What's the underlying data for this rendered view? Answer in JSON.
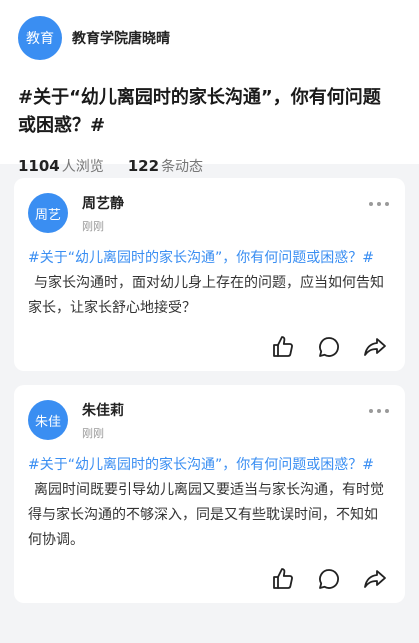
{
  "header": {
    "owner_avatar": "教育",
    "owner_name": "教育学院唐晓晴",
    "topic_title": "#关于“幼儿离园时的家长沟通”，你有何问题或困惑？#",
    "views_count": "1104",
    "views_label": "人浏览",
    "posts_count": "122",
    "posts_label": "条动态"
  },
  "posts": [
    {
      "avatar": "周艺",
      "name": "周艺静",
      "time": "刚刚",
      "tag": "#关于“幼儿离园时的家长沟通”，你有何问题或困惑？#",
      "text": "与家长沟通时，面对幼儿身上存在的问题，应当如何告知家长，让家长舒心地接受？"
    },
    {
      "avatar": "朱佳",
      "name": "朱佳莉",
      "time": "刚刚",
      "tag": "#关于“幼儿离园时的家长沟通”，你有何问题或困惑？#",
      "text": "离园时间既要引导幼儿离园又要适当与家长沟通，有时觉得与家长沟通的不够深入，同是又有些耽误时间，不知如何协调。"
    }
  ],
  "icons": {
    "more": "more-horizontal-icon",
    "like": "thumbs-up-icon",
    "comment": "comment-icon",
    "share": "share-icon"
  },
  "colors": {
    "accent": "#3a8ef2",
    "background": "#f3f4f6"
  }
}
